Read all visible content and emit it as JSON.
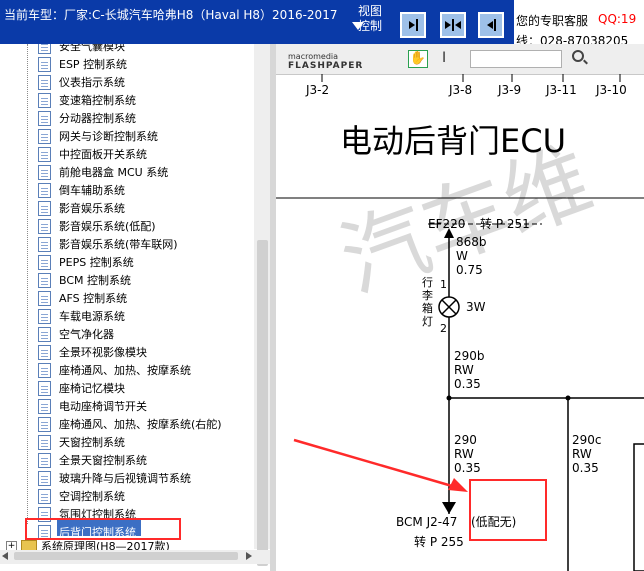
{
  "header": {
    "title": "当前车型：厂家:C-长城汽车哈弗H8（Haval H8）2016-2017",
    "view_control_label": "视图\n控制",
    "service_label": "您的专职客服",
    "qq_label": "QQ:19",
    "phone_label": "线：028-87038205",
    "colors": {
      "bar": "#0a3aa8",
      "qq": "#ff0000"
    },
    "view_buttons": [
      {
        "icon": "collapse-left-icon"
      },
      {
        "icon": "split-view-icon"
      },
      {
        "icon": "collapse-right-icon"
      }
    ]
  },
  "tree": {
    "items": [
      "安全气囊模块",
      "ESP 控制系统",
      "仪表指示系统",
      "变速箱控制系统",
      "分动器控制系统",
      "网关与诊断控制系统",
      "中控面板开关系统",
      "前舱电器盒 MCU 系统",
      "倒车辅助系统",
      "影音娱乐系统",
      "影音娱乐系统(低配)",
      "影音娱乐系统(带车联网)",
      "PEPS 控制系统",
      "BCM 控制系统",
      "AFS 控制系统",
      "车载电源系统",
      "空气净化器",
      "全景环视影像模块",
      "座椅通风、加热、按摩系统",
      "座椅记忆模块",
      "电动座椅调节开关",
      "座椅通风、加热、按摩系统(右舵)",
      "天窗控制系统",
      "全景天窗控制系统",
      "玻璃升降与后视镜调节系统",
      "空调控制系统",
      "氛围灯控制系统",
      "后背门控制系统"
    ],
    "selected_index": 27,
    "footer_node": "系统原理图(H8—2017款)",
    "highlight_color": "#ff2a2a"
  },
  "viewer": {
    "toolbar": {
      "logo_top": "macromedia",
      "logo_bottom": "FLASHPAPER",
      "hand_icon": "hand-icon",
      "cursor_icon": "text-cursor-icon",
      "search_icon": "search-icon"
    },
    "diagram": {
      "connectors": [
        "J3-2",
        "J3-8",
        "J3-9",
        "J3-11",
        "J3-10"
      ],
      "title": "电动后背门ECU",
      "fuse_label": "EF220",
      "fuse_ref": "转 P 251",
      "wire1": {
        "id": "868b",
        "color": "W",
        "size": "0.75"
      },
      "lamp_pins": [
        "1",
        "2"
      ],
      "lamp_name": "行李箱灯",
      "lamp_power": "3W",
      "wire2": {
        "id": "290b",
        "color": "RW",
        "size": "0.35"
      },
      "wire3": {
        "id": "290",
        "color": "RW",
        "size": "0.35"
      },
      "wire4": {
        "id": "290c",
        "color": "RW",
        "size": "0.35"
      },
      "bcm_label": "BCM J2-47",
      "bcm_note": "(低配无)",
      "bcm_ref": "转 P 255",
      "watermark": "汽车维"
    }
  }
}
